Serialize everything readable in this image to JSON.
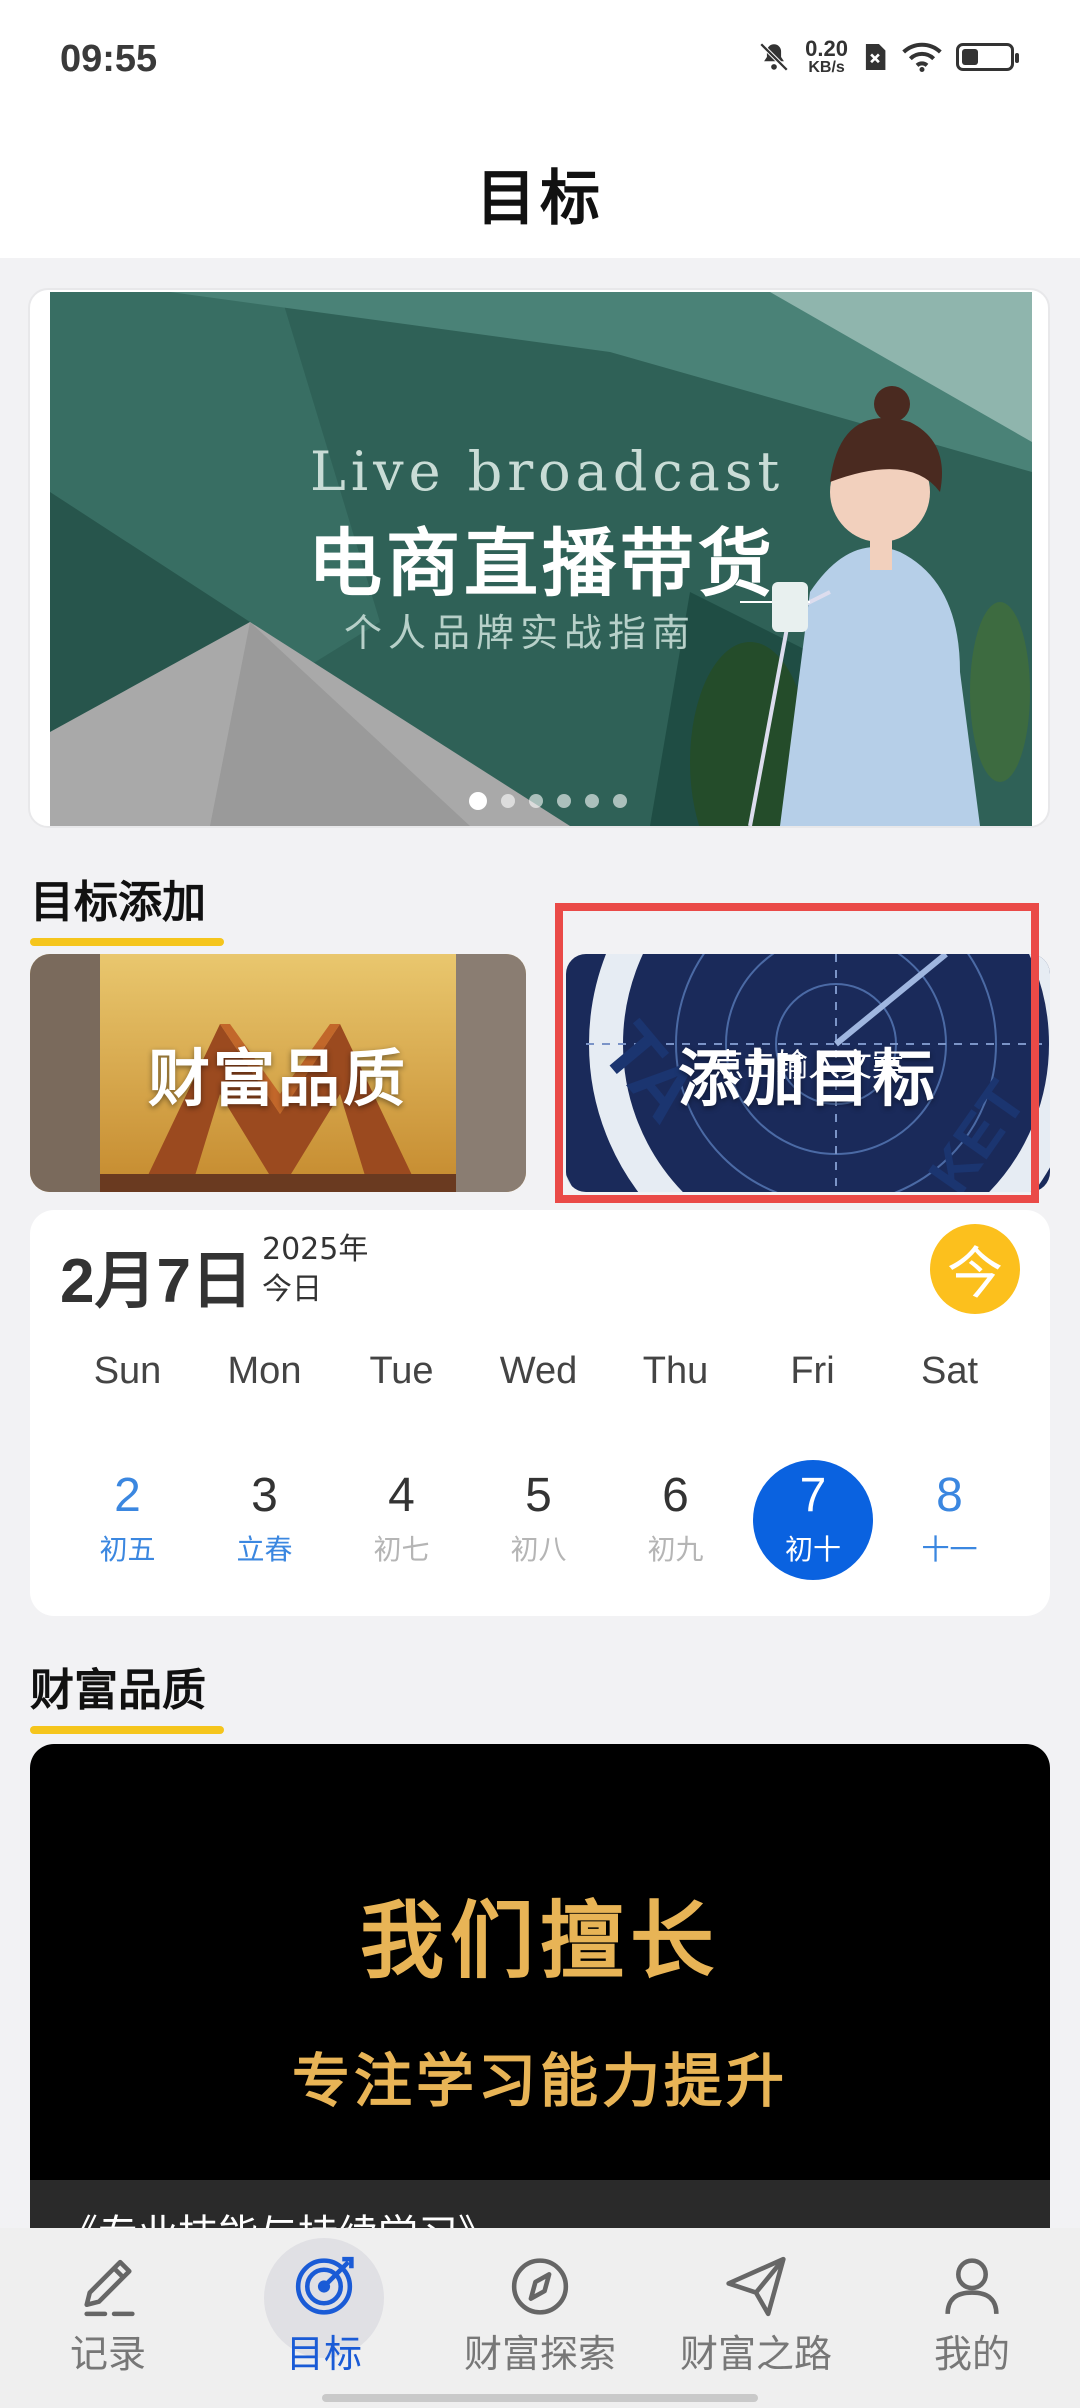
{
  "status": {
    "time": "09:55",
    "net_speed": "0.20",
    "net_unit": "KB/s",
    "battery_level": 0.35
  },
  "header": {
    "title": "目标"
  },
  "banner": {
    "title_en": "Live broadcast",
    "title_zh": "电商直播带货",
    "subtitle": "个人品牌实战指南",
    "slide_count": 6,
    "active_slide": 0
  },
  "goal_add": {
    "heading": "目标添加",
    "cards": [
      {
        "label": "财富品质"
      },
      {
        "label": "添加目标",
        "overlay": "点击输入文案"
      }
    ]
  },
  "calendar": {
    "date": "2月7日",
    "year": "2025年",
    "today_label": "今日",
    "today_button": "今",
    "weekdays": [
      "Sun",
      "Mon",
      "Tue",
      "Wed",
      "Thu",
      "Fri",
      "Sat"
    ],
    "days": [
      {
        "num": "2",
        "lunar": "初五"
      },
      {
        "num": "3",
        "lunar": "立春"
      },
      {
        "num": "4",
        "lunar": "初七"
      },
      {
        "num": "5",
        "lunar": "初八"
      },
      {
        "num": "6",
        "lunar": "初九"
      },
      {
        "num": "7",
        "lunar": "初十"
      },
      {
        "num": "8",
        "lunar": "十一"
      }
    ],
    "colors": {
      "selected": "#0a62e0",
      "weekend": "#3b87e0",
      "today_button": "#fcc01d"
    }
  },
  "wealth": {
    "heading": "财富品质",
    "line1": "我们擅长",
    "line2": "专注学习能力提升",
    "caption": "《专业技能与持续学习》"
  },
  "nav": {
    "items": [
      {
        "label": "记录",
        "icon": "pencil-icon"
      },
      {
        "label": "目标",
        "icon": "target-icon"
      },
      {
        "label": "财富探索",
        "icon": "compass-icon"
      },
      {
        "label": "财富之路",
        "icon": "send-icon"
      },
      {
        "label": "我的",
        "icon": "person-icon"
      }
    ],
    "active_color": "#1a5bd6"
  }
}
